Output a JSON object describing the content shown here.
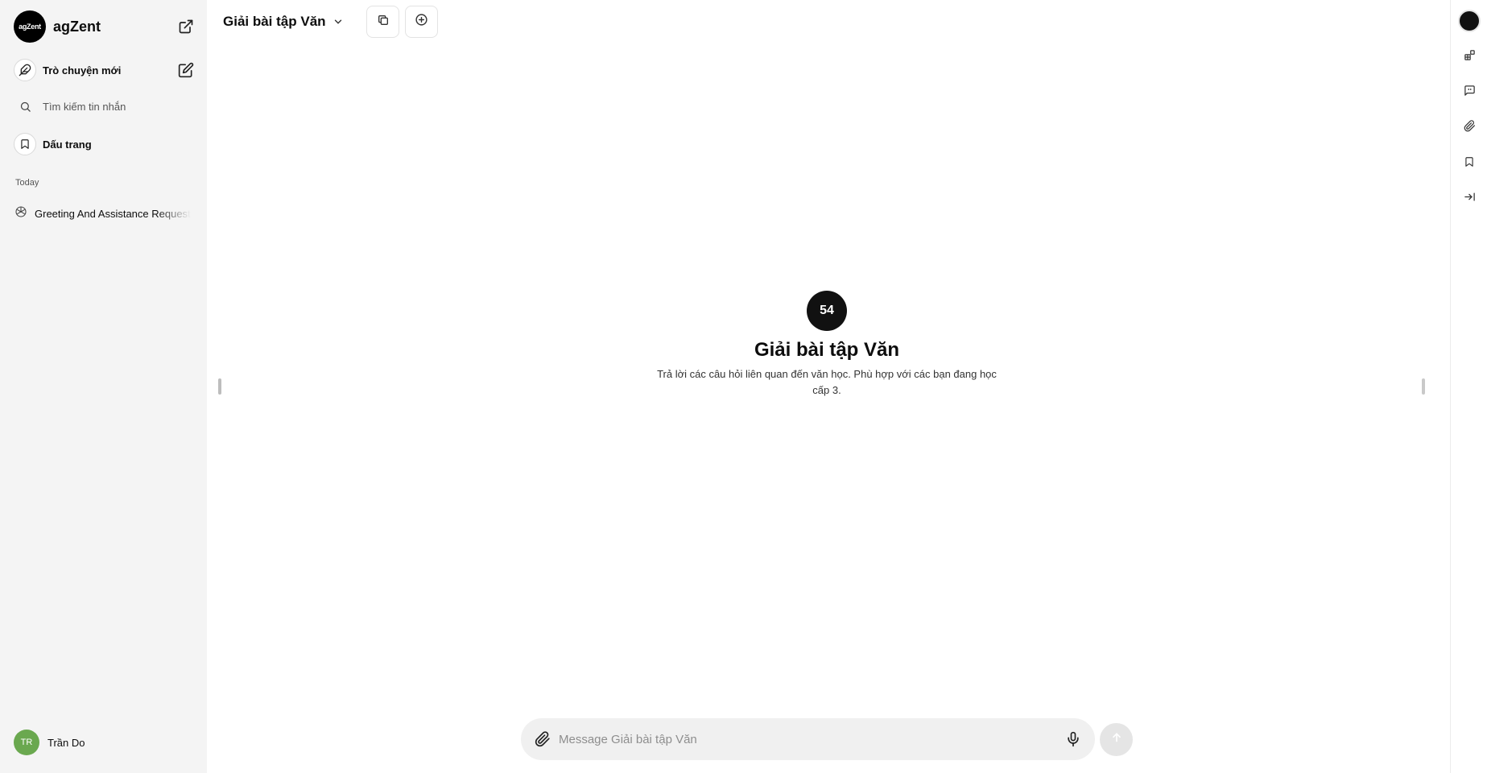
{
  "brand": {
    "name": "agZent",
    "logo_text": "agZent"
  },
  "sidebar": {
    "new_chat_label": "Trò chuyện mới",
    "search_label": "Tìm kiếm tin nhắn",
    "bookmarks_label": "Dấu trang",
    "section_today": "Today",
    "history": [
      {
        "label": "Greeting And Assistance Request"
      }
    ]
  },
  "user": {
    "initials": "TR",
    "name": "Trần Do"
  },
  "header": {
    "model_name": "Giải bài tập Văn"
  },
  "agent": {
    "logo_text": "54",
    "title": "Giải bài tập Văn",
    "description": "Trả lời các câu hỏi liên quan đến văn học. Phù hợp với các bạn đang học cấp 3."
  },
  "composer": {
    "placeholder": "Message Giải bài tập Văn"
  },
  "colors": {
    "sidebar_bg": "#f4f4f4",
    "avatar_bg": "#6aa84f",
    "composer_bg": "#f0f0f0",
    "send_bg": "#e5e5e5"
  }
}
